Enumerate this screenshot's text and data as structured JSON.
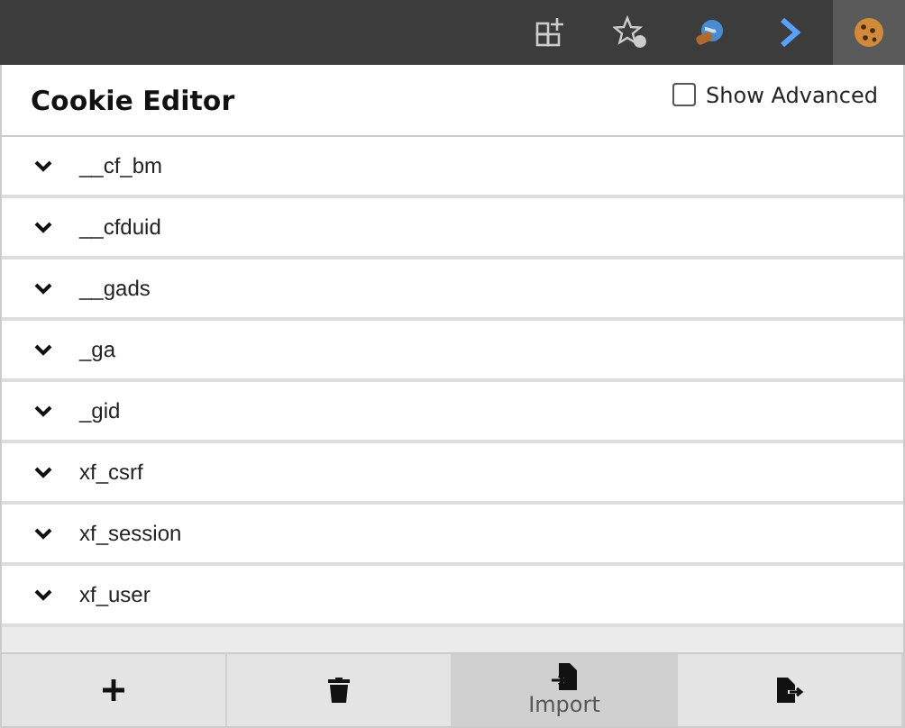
{
  "browser_toolbar": {
    "icons": [
      {
        "kind": "tab-add",
        "selected": false
      },
      {
        "kind": "favorites",
        "selected": false
      },
      {
        "kind": "globe",
        "selected": false
      },
      {
        "kind": "arrow",
        "selected": false
      },
      {
        "kind": "cookie",
        "selected": true
      }
    ]
  },
  "header": {
    "title": "Cookie Editor",
    "show_advanced": {
      "label": "Show Advanced",
      "checked": false
    }
  },
  "cookies": [
    {
      "name": "__cf_bm",
      "expanded": false
    },
    {
      "name": "__cfduid",
      "expanded": false
    },
    {
      "name": "__gads",
      "expanded": false
    },
    {
      "name": "_ga",
      "expanded": false
    },
    {
      "name": "_gid",
      "expanded": false
    },
    {
      "name": "xf_csrf",
      "expanded": false
    },
    {
      "name": "xf_session",
      "expanded": false
    },
    {
      "name": "xf_user",
      "expanded": false
    }
  ],
  "buttons": [
    {
      "kind": "add",
      "hovered": false
    },
    {
      "kind": "delete",
      "hovered": false
    },
    {
      "kind": "import",
      "label": "Import",
      "hovered": true
    },
    {
      "kind": "export",
      "hovered": false
    }
  ]
}
